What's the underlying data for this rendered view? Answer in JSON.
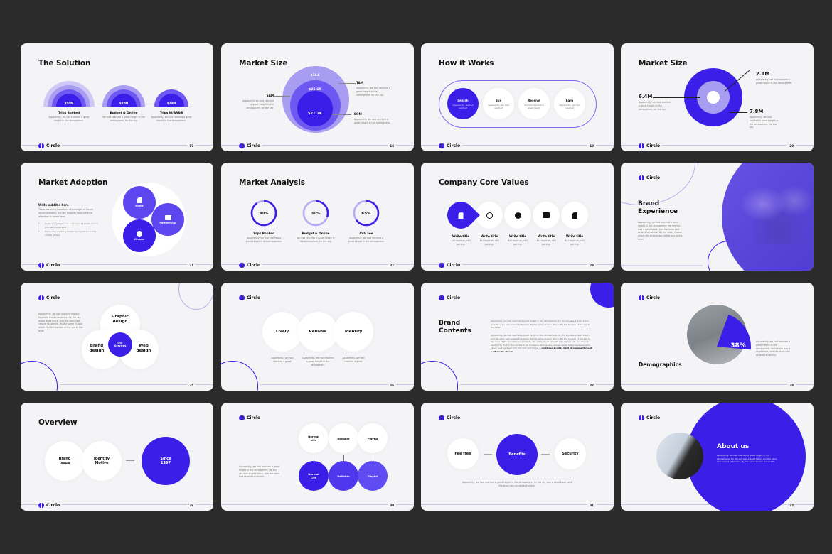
{
  "brand": {
    "name": "Circlo",
    "accent": "#3b1ee8",
    "accent_light": "#a99df2",
    "accent_mid": "#5d45f0",
    "bg": "#f4f4f6",
    "canvas": "#2b2b2b"
  },
  "slides": [
    {
      "title": "The Solution",
      "page": "17",
      "items": [
        {
          "value": "$50M",
          "label": "Trips Booked",
          "desc": "Apparently, we had reached a great height in the atmosphere."
        },
        {
          "value": "$42M",
          "label": "Budget & Online",
          "desc": "We had reached a great height in the atmosphere, for the sky."
        },
        {
          "value": "$28M",
          "label": "Trips W/AR&B",
          "desc": "Apparently, we had reached a great height in the atmosphere."
        }
      ]
    },
    {
      "title": "Market Size",
      "page": "18",
      "circles": [
        {
          "value": "$34.6"
        },
        {
          "value": "$25.6K"
        },
        {
          "value": "$21.2K"
        }
      ],
      "sam": {
        "label": "SAM",
        "desc": "Apparently we had reached a great height in the atmosphere, for the sky."
      },
      "tam": {
        "label": "TAM",
        "desc": "Apparently, we had reached a great height in the atmosphere, for the sky."
      },
      "som": {
        "label": "SOM",
        "desc": "Apparently, we had reached a great height in the atmosphere."
      }
    },
    {
      "title": "How it Works",
      "page": "19",
      "steps": [
        {
          "label": "Search",
          "desc": "Apparently, we had reached"
        },
        {
          "label": "Buy",
          "desc": "Apparently, we had reached"
        },
        {
          "label": "Receive",
          "desc": "We had reached a great height"
        },
        {
          "label": "Earn",
          "desc": "Apparently, we had reached"
        }
      ]
    },
    {
      "title": "Market Size",
      "page": "20",
      "a": {
        "value": "2.1M",
        "desc": "Apparently, we had reached a great height in the atmosphere."
      },
      "b": {
        "value": "6.4M",
        "desc": "Apparently, we had reached a great height in the atmosphere, for the sky."
      },
      "c": {
        "value": "7.8M",
        "desc": "Apparently, we had reached a great height in the atmosphere, for the sky."
      }
    },
    {
      "title": "Market Adoption",
      "page": "21",
      "subtitle": "Write subtitle here",
      "body": "There are many variations of passages of Lorem Ipsum available, but the majority have suffered alteration in some form.",
      "bullets": [
        "If you are going to use a passage of Lorem Ipsum, you need to be sure",
        "There isn't anything embarrassing hidden in the middle of text."
      ],
      "circles": [
        {
          "label": "Event"
        },
        {
          "label": "Partnership"
        },
        {
          "label": "Groups"
        }
      ]
    },
    {
      "title": "Market Analysis",
      "page": "22",
      "items": [
        {
          "percent": 90,
          "value": "90%",
          "label": "Trips Booked",
          "desc": "Apparently, we had reached a great height in the atmosphere."
        },
        {
          "percent": 30,
          "value": "30%",
          "label": "Budget & Online",
          "desc": "We had reached a great height in the atmosphere, for the sky."
        },
        {
          "percent": 65,
          "value": "65%",
          "label": "AVG Fee",
          "desc": "Apparently, we had reached a great height in the atmosphere."
        }
      ]
    },
    {
      "title": "Company Core Values",
      "page": "23",
      "items": [
        {
          "icon": "chess-knight-icon",
          "title": "Write title",
          "desc": "As I want on, still gaining."
        },
        {
          "icon": "target-icon",
          "title": "Write title",
          "desc": "As I want on, still gaining."
        },
        {
          "icon": "clock-icon",
          "title": "Write title",
          "desc": "As I want on, still gaining."
        },
        {
          "icon": "briefcase-icon",
          "title": "Write title",
          "desc": "As I want on, still gaining."
        },
        {
          "icon": "chess-knight-icon",
          "title": "Write title",
          "desc": "As I want on, still gaining."
        }
      ]
    },
    {
      "title": "Brand Experience",
      "body": "Apparently, we had reached a great height in the atmosphere, for the sky was a dead black, and the stars had ceased to twinkle. By the same illusion which lifts the horizon of the sea to the level"
    },
    {
      "page": "25",
      "body": "Apparently, we had reached a great height in the atmosphere, for the sky was a dead black, and the stars had ceased to twinkle. By the same illusion which lifts the horizon of the sea to the level",
      "center": "Our Services",
      "circles": [
        {
          "label": "Graphic design"
        },
        {
          "label": "Brand design"
        },
        {
          "label": "Web design"
        }
      ]
    },
    {
      "page": "26",
      "items": [
        {
          "label": "Lively",
          "desc": "Apparently, we had reached a great"
        },
        {
          "label": "Reliable",
          "desc": "Apparently, we had reached a great height in the atmosphere"
        },
        {
          "label": "Identity",
          "desc": "Apparently, we had reached a great"
        }
      ]
    },
    {
      "title": "Brand Contents",
      "page": "27",
      "p1": "Apparently, we had reached a great height in the atmosphere, for the sky was a dead black, and the stars had ceased to twinkle. By the same illusion which lifts the horizon of the sea to the level.",
      "p2": "Apparently, we had reached a great height in the atmosphere, for the sky was a dead black, and the stars had ceased to twinkle. By the same illusion which lifts the horizon of the sea to the level of the spectator on a hillside, the sable cloud beneath was dished out, and the car seemed to float in the middle of an immense dark sphere, whose upper half was strewn with silver. Looking down into the dark gulf below,",
      "p2_bold": "I could see a ruddy light streaming through a rift in the clouds."
    },
    {
      "title": "Demographics",
      "page": "28",
      "value": "38%",
      "percent": 38,
      "desc": "Apparently, we had reached a great height in the atmosphere, for the sky was a dead black, and the stars had ceased to twinkle."
    },
    {
      "title": "Overview",
      "page": "29",
      "items": [
        {
          "label": "Brand Issue"
        },
        {
          "label": "Identity Motive"
        }
      ],
      "highlight": "Since 1997"
    },
    {
      "page": "30",
      "body": "Apparently, we had reached a great height in the atmosphere, for the sky was a dead black, and the stars had ceased to twinkle.",
      "top": [
        {
          "label": "Normal Life"
        },
        {
          "label": "Reliable"
        },
        {
          "label": "Playful"
        }
      ],
      "bottom": [
        {
          "label": "Normal Life"
        },
        {
          "label": "Reliable"
        },
        {
          "label": "Playful"
        }
      ]
    },
    {
      "page": "31",
      "items": [
        {
          "label": "Fee free"
        },
        {
          "label": "Benefits"
        },
        {
          "label": "Security"
        }
      ],
      "desc": "Apparently, we had reached a great height in the atmosphere, for the sky was a dead black, and the stars had ceased to twinkle."
    },
    {
      "title": "About us",
      "page": "32",
      "body": "Apparently, we had reached a great height in the atmosphere, for the sky was a dead black, and the stars had ceased to twinkle. By the same illusion which lifts"
    }
  ]
}
